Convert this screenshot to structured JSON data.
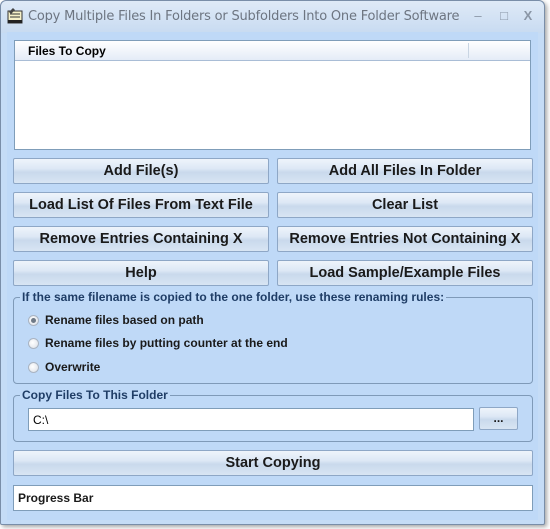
{
  "window": {
    "title": "Copy Multiple Files In Folders or Subfolders Into One Folder Software",
    "controls": {
      "minimize": "–",
      "maximize": "□",
      "close": "X"
    },
    "app_icon": "notepad-icon"
  },
  "file_list": {
    "columns": [
      "Files To Copy",
      ""
    ],
    "rows": []
  },
  "buttons": {
    "add_files": "Add File(s)",
    "add_all_in_folder": "Add All Files In Folder",
    "load_list": "Load List Of Files From Text File",
    "clear_list": "Clear List",
    "remove_containing": "Remove Entries Containing X",
    "remove_not_containing": "Remove Entries Not Containing X",
    "help": "Help",
    "load_sample": "Load Sample/Example Files",
    "browse": "...",
    "start": "Start Copying"
  },
  "renaming_rules": {
    "legend": "If the same filename is copied to the one folder, use these renaming rules:",
    "options": [
      {
        "label": "Rename files based on path",
        "checked": true
      },
      {
        "label": "Rename files by putting counter at the end",
        "checked": false
      },
      {
        "label": "Overwrite",
        "checked": false
      }
    ]
  },
  "destination": {
    "legend": "Copy Files To This Folder",
    "value": "C:\\"
  },
  "progress": {
    "label": "Progress Bar",
    "percent": 0
  }
}
